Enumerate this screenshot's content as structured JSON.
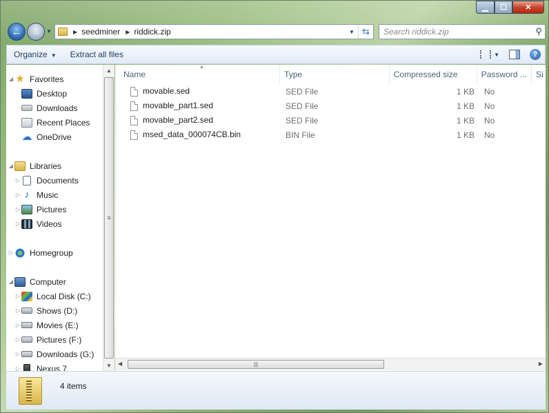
{
  "window": {
    "min_label": "▁",
    "max_label": "☐",
    "close_label": "✕"
  },
  "nav": {
    "back_glyph": "←",
    "forward_glyph": "→"
  },
  "address": {
    "crumbs": [
      "seedminer",
      "riddick.zip"
    ]
  },
  "search": {
    "placeholder": "Search riddick.zip"
  },
  "toolbar": {
    "organize": "Organize",
    "extract": "Extract all files",
    "help": "?"
  },
  "navpane": {
    "favorites": {
      "header": "Favorites",
      "items": [
        "Desktop",
        "Downloads",
        "Recent Places",
        "OneDrive"
      ]
    },
    "libraries": {
      "header": "Libraries",
      "items": [
        "Documents",
        "Music",
        "Pictures",
        "Videos"
      ]
    },
    "homegroup": {
      "header": "Homegroup"
    },
    "computer": {
      "header": "Computer",
      "items": [
        "Local Disk (C:)",
        "Shows (D:)",
        "Movies (E:)",
        "Pictures (F:)",
        "Downloads (G:)",
        "Nexus 7"
      ]
    }
  },
  "columns": [
    "Name",
    "Type",
    "Compressed size",
    "Password ...",
    "Si"
  ],
  "files": [
    {
      "name": "movable.sed",
      "type": "SED File",
      "size": "1 KB",
      "password": "No"
    },
    {
      "name": "movable_part1.sed",
      "type": "SED File",
      "size": "1 KB",
      "password": "No"
    },
    {
      "name": "movable_part2.sed",
      "type": "SED File",
      "size": "1 KB",
      "password": "No"
    },
    {
      "name": "msed_data_000074CB.bin",
      "type": "BIN File",
      "size": "1 KB",
      "password": "No"
    }
  ],
  "status": {
    "count": "4 items"
  }
}
